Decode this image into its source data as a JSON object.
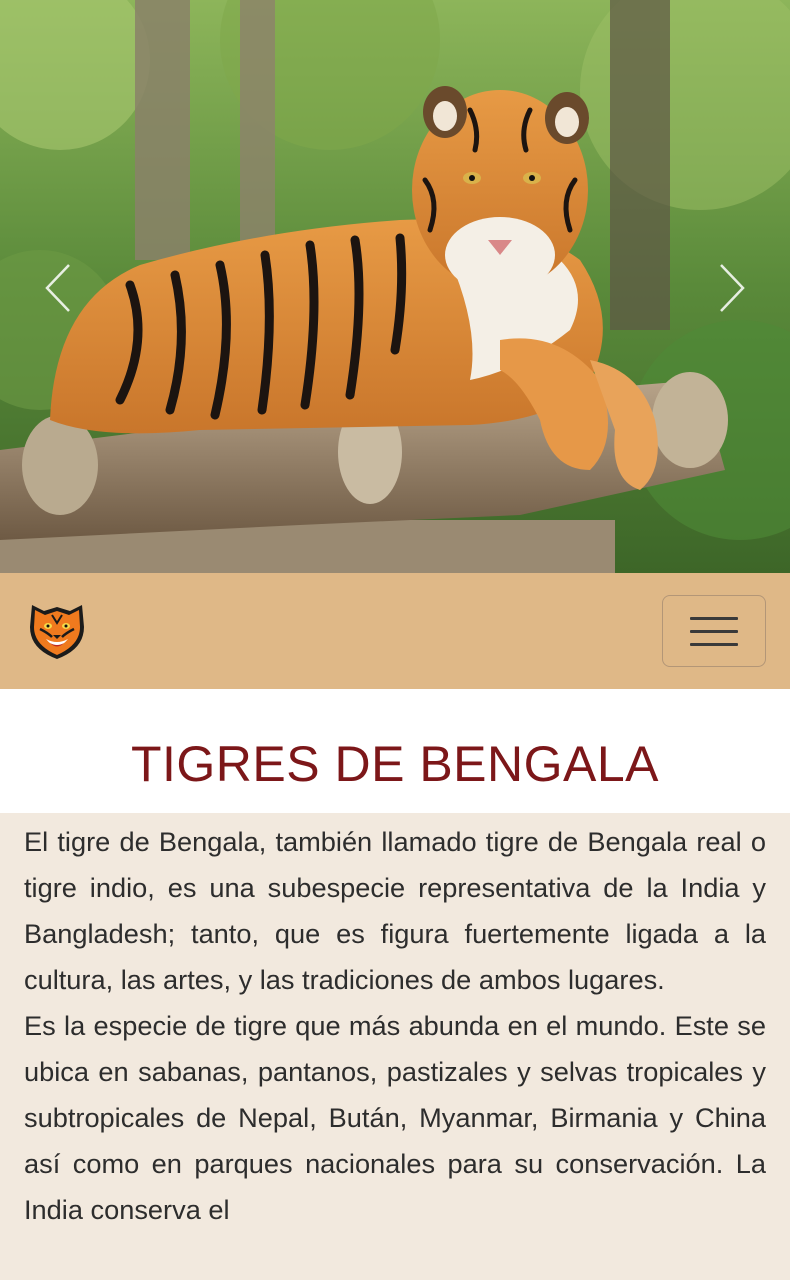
{
  "hero": {
    "image_alt": "Tigre de Bengala recostado sobre troncos",
    "prev_icon": "chevron-left-icon",
    "next_icon": "chevron-right-icon"
  },
  "navbar": {
    "logo_icon": "tiger-head-icon",
    "menu_icon": "hamburger-menu-icon"
  },
  "main": {
    "title": "TIGRES DE BENGALA",
    "paragraphs": [
      "El tigre de Bengala, también llamado tigre de Bengala real o tigre indio, es una subespecie representativa de la India y Bangladesh; tanto, que es figura fuertemente ligada a la cultura, las artes, y las tradiciones de ambos lugares.",
      "Es la especie de tigre que más abunda en el mundo. Este se ubica en sabanas, pantanos, pastizales y selvas tropicales y subtropicales de Nepal, Bután, Myanmar, Birmania y China así como en parques nacionales para su conservación. La India conserva el"
    ]
  },
  "colors": {
    "navbar_bg": "#dfb887",
    "title_color": "#7c1719",
    "content_bg": "#f2e9de"
  }
}
